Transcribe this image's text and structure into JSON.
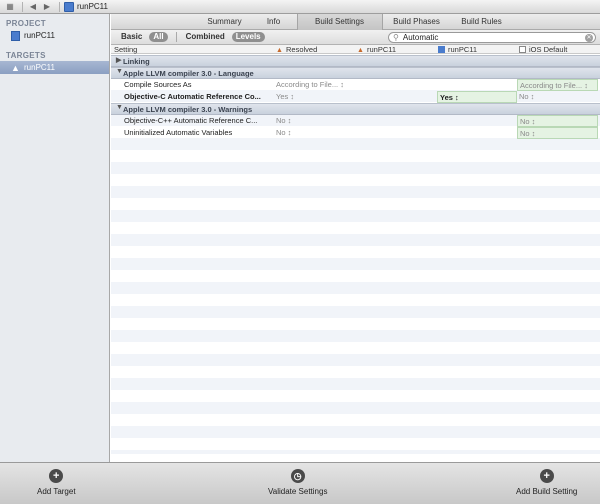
{
  "jumpbar": {
    "title": "runPC11"
  },
  "sidebar": {
    "project_header": "PROJECT",
    "project_item": "runPC11",
    "targets_header": "TARGETS",
    "target_item": "runPC11"
  },
  "tabs": [
    "Summary",
    "Info",
    "Build Settings",
    "Build Phases",
    "Build Rules"
  ],
  "filters": {
    "basic": "Basic",
    "all": "All",
    "combined": "Combined",
    "levels": "Levels"
  },
  "search": {
    "value": "Automatic"
  },
  "columns": {
    "setting": "Setting",
    "resolved": "Resolved",
    "target": "runPC11",
    "project": "runPC11",
    "ios_default": "iOS Default"
  },
  "rows": {
    "linking": "Linking",
    "lang_section": "Apple LLVM compiler 3.0 - Language",
    "compile_sources": {
      "name": "Compile Sources As",
      "resolved": "According to File... ↕",
      "default": "According to File... ↕"
    },
    "objc_arc": {
      "name": "Objective-C Automatic Reference Co...",
      "resolved": "Yes ↕",
      "project": "Yes ↕",
      "default": "No ↕"
    },
    "warn_section": "Apple LLVM compiler 3.0 - Warnings",
    "objcpp_arc": {
      "name": "Objective-C++ Automatic Reference C...",
      "resolved": "No ↕",
      "default": "No ↕"
    },
    "uninit": {
      "name": "Uninitialized Automatic Variables",
      "resolved": "No ↕",
      "default": "No ↕"
    }
  },
  "bottom": {
    "add_target": "Add Target",
    "validate": "Validate Settings",
    "add_build_setting": "Add Build Setting"
  }
}
